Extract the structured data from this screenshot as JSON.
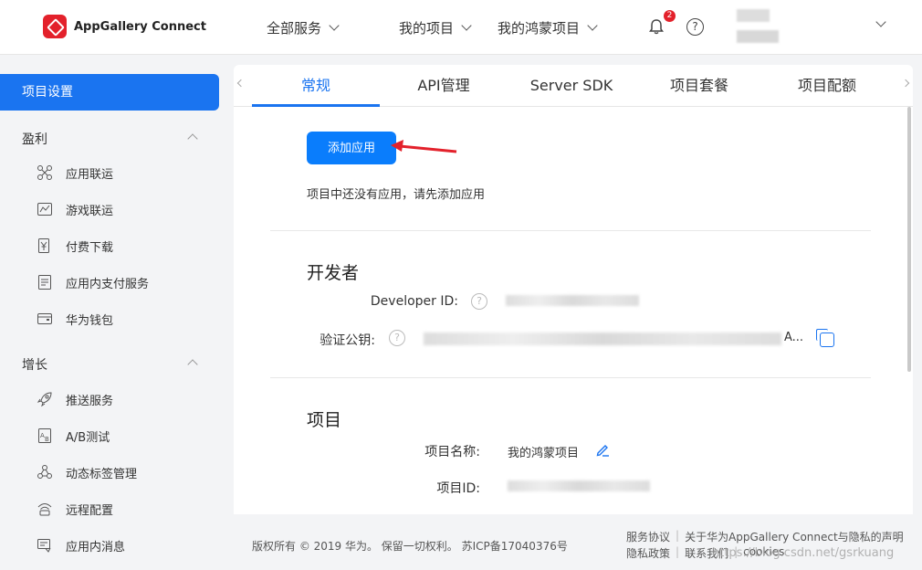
{
  "brand": {
    "name": "AppGallery Connect"
  },
  "topnav": {
    "all_services": "全部服务",
    "my_projects": "我的项目",
    "my_harmony_projects": "我的鸿蒙项目",
    "notification_count": "2",
    "help_glyph": "?"
  },
  "sidebar": {
    "active": "项目设置",
    "groups": [
      {
        "title": "盈利",
        "items": [
          "应用联运",
          "游戏联运",
          "付费下载",
          "应用内支付服务",
          "华为钱包"
        ]
      },
      {
        "title": "增长",
        "items": [
          "推送服务",
          "A/B测试",
          "动态标签管理",
          "远程配置",
          "应用内消息"
        ]
      }
    ]
  },
  "tabs": [
    "常规",
    "API管理",
    "Server SDK",
    "项目套餐",
    "项目配额"
  ],
  "main": {
    "add_app_button": "添加应用",
    "empty_hint": "项目中还没有应用，请先添加应用",
    "developer": {
      "title": "开发者",
      "developer_id_label": "Developer ID:",
      "public_key_label": "验证公钥:",
      "public_key_suffix": "A..."
    },
    "project": {
      "title": "项目",
      "name_label": "项目名称:",
      "name_value": "我的鸿蒙项目",
      "id_label": "项目ID:"
    }
  },
  "footer": {
    "copyright": "版权所有 © 2019 华为。 保留一切权利。 苏ICP备17040376号",
    "links_row1": [
      "服务协议",
      "关于华为AppGallery Connect与隐私的声明"
    ],
    "links_row2": [
      "隐私政策",
      "联系我们",
      "cookies"
    ],
    "watermark": "https://blog.csdn.net/gsrkuang"
  },
  "colors": {
    "accent": "#1a74f0",
    "brand_red": "#e3212b"
  }
}
